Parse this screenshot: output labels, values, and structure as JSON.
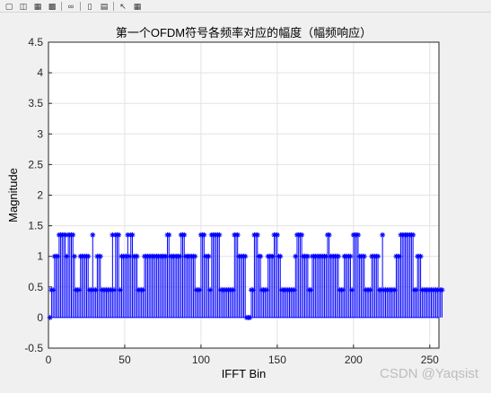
{
  "toolbar": {
    "icons": [
      "new-figure-icon",
      "open-file-icon",
      "save-icon",
      "print-icon",
      "link-icon",
      "insert-colorbar-icon",
      "insert-legend-icon",
      "pointer-arrow-icon",
      "property-editor-icon"
    ]
  },
  "watermark": "CSDN @Yaqsist",
  "chart_data": {
    "type": "stem",
    "title": "第一个OFDM符号各频率对应的幅度（幅频响应）",
    "xlabel": "IFFT Bin",
    "ylabel": "Magnitude",
    "xlim": [
      0,
      256
    ],
    "ylim": [
      -0.5,
      4.5
    ],
    "xticks": [
      0,
      50,
      100,
      150,
      200,
      250
    ],
    "xtick_labels": [
      "0",
      "50",
      "100",
      "150",
      "200",
      "250"
    ],
    "yticks": [
      -0.5,
      0,
      0.5,
      1,
      1.5,
      2,
      2.5,
      3,
      3.5,
      4,
      4.5
    ],
    "ytick_labels": [
      "-0.5",
      "0",
      "0.5",
      "1",
      "1.5",
      "2",
      "2.5",
      "3",
      "3.5",
      "4",
      "4.5"
    ],
    "grid": true,
    "marker": "*",
    "color": "#0000ff",
    "x_start": 1,
    "values": [
      0,
      0.45,
      0.45,
      1,
      1,
      1,
      1.35,
      1.35,
      1.35,
      1.35,
      1.35,
      1,
      1.35,
      1.35,
      1.35,
      1.35,
      1,
      0.45,
      0.45,
      0.45,
      1,
      1,
      1,
      1,
      1,
      1,
      0.45,
      0.45,
      1.35,
      0.45,
      0.45,
      1,
      1,
      1,
      0.45,
      0.45,
      0.45,
      0.45,
      0.45,
      0.45,
      0.45,
      1.35,
      0.45,
      1.35,
      1.35,
      1.35,
      0.45,
      1,
      1,
      1,
      1,
      1.35,
      1,
      1.35,
      1.35,
      1,
      1,
      1,
      0.45,
      0.45,
      0.45,
      0.45,
      1,
      1,
      1,
      1,
      1,
      1,
      1,
      1,
      1,
      1,
      1,
      1,
      1,
      1,
      1,
      1.35,
      1.35,
      1,
      1,
      1,
      1,
      1,
      1,
      1,
      1.35,
      1.35,
      1.35,
      1,
      1,
      1,
      1,
      1,
      1,
      1,
      0.45,
      0.45,
      0.45,
      1.35,
      1.35,
      1.35,
      1,
      1,
      1,
      0.45,
      1.35,
      1.35,
      1.35,
      1.35,
      1.35,
      1.35,
      0.45,
      0.45,
      0.45,
      0.45,
      0.45,
      0.45,
      0.45,
      0.45,
      0.45,
      1.35,
      1.35,
      1.35,
      1,
      1,
      1,
      1,
      1,
      0,
      0,
      0,
      0.45,
      0.45,
      1.35,
      1.35,
      1.35,
      1,
      1,
      0.45,
      0.45,
      0.45,
      0.45,
      1,
      1,
      1,
      1,
      1.35,
      1.35,
      1.35,
      1,
      1,
      0.45,
      0.45,
      0.45,
      0.45,
      0.45,
      0.45,
      0.45,
      0.45,
      0.45,
      1,
      1.35,
      1.35,
      1.35,
      1.35,
      1,
      1,
      1,
      1,
      0.45,
      0.45,
      1,
      1,
      1,
      1,
      1,
      1,
      1,
      1,
      1,
      1,
      1.35,
      1.35,
      1,
      1,
      1,
      1,
      1,
      1,
      0.45,
      0.45,
      0.45,
      1,
      1,
      1,
      1,
      1,
      0.45,
      1.35,
      1.35,
      1.35,
      1.35,
      1,
      1,
      1,
      1,
      0.45,
      0.45,
      0.45,
      0.45,
      1,
      1,
      1,
      1,
      1,
      0.45,
      0.45,
      1.35,
      0.45,
      0.45,
      0.45,
      0.45,
      0.45,
      0.45,
      0.45,
      0.45,
      1,
      1,
      1,
      1.35,
      1.35,
      1.35,
      1.35,
      1.35,
      1.35,
      1.35,
      1.35,
      1.35,
      0.45,
      0.45,
      1,
      1,
      1,
      0.45,
      0.45,
      0.45,
      0.45,
      0.45,
      0.45,
      0.45,
      0.45,
      0.45,
      0.45,
      0.45,
      0.45,
      0.45,
      0.45
    ]
  }
}
